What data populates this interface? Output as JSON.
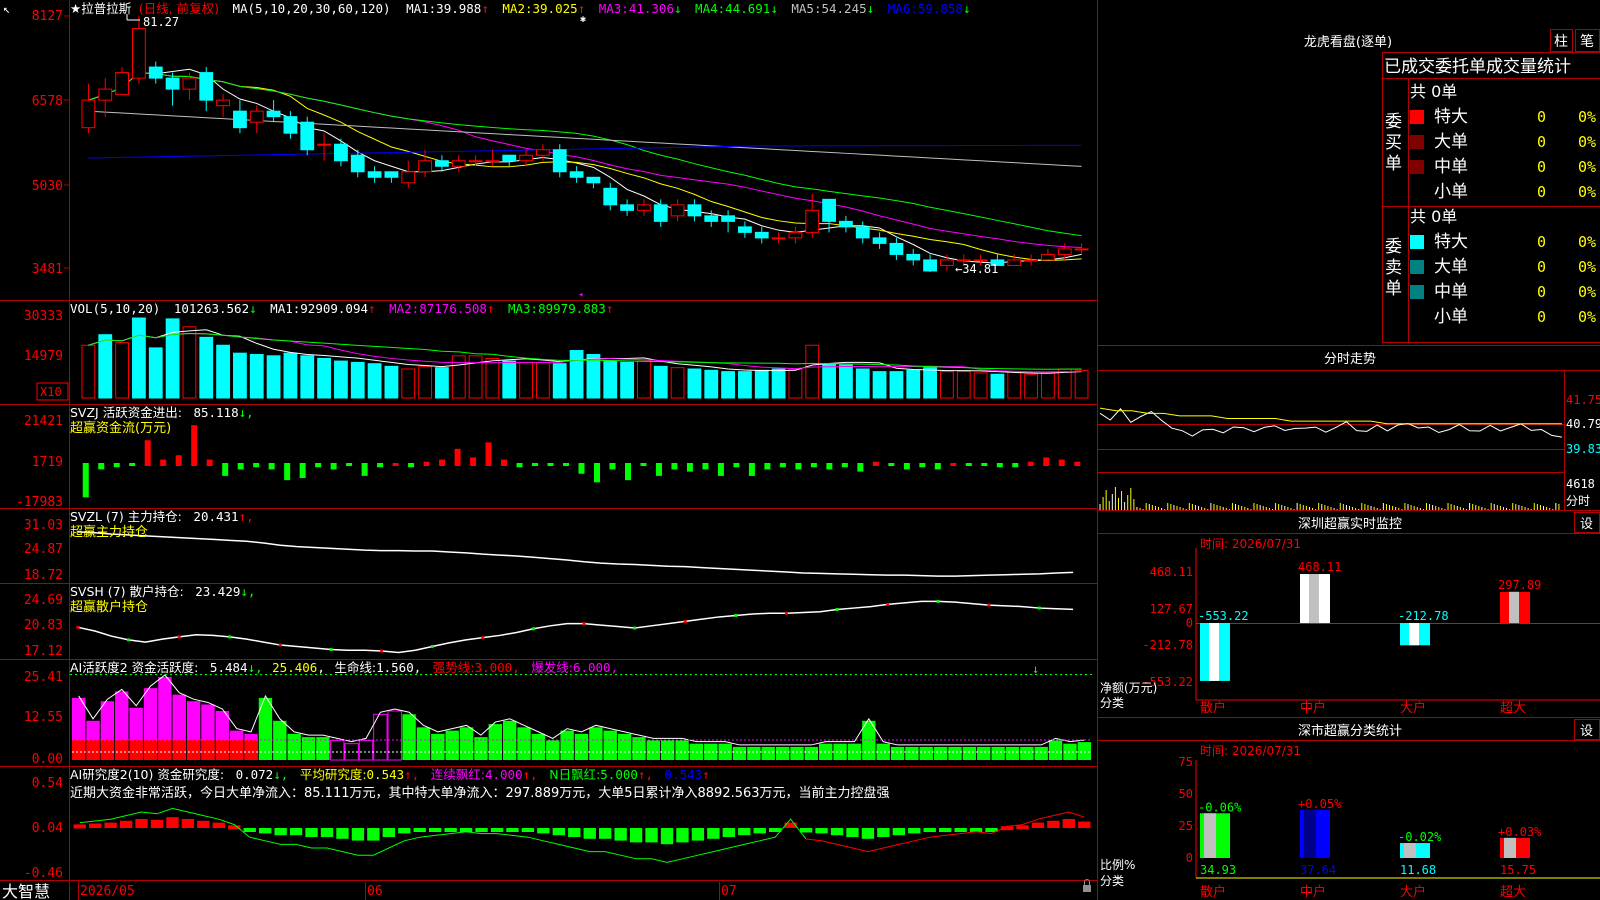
{
  "colors": {
    "red": "#ff0000",
    "cyan": "#00ffff",
    "green": "#00ff00",
    "white": "#ffffff",
    "yellow": "#ffff00",
    "magenta": "#ff00ff",
    "blue": "#0000ff",
    "gray": "#909090",
    "border": "#b00000",
    "grid": "#800000",
    "teal": "#008080",
    "darkred": "#800000"
  },
  "main": {
    "title": "★拉普拉斯",
    "period": "(日线, 前复权)",
    "ma_params": "MA(5,10,20,30,60,120)",
    "ma": [
      {
        "label": "MA1:",
        "value": "39.988",
        "arrow": "↑",
        "color": "#ffffff"
      },
      {
        "label": "MA2:",
        "value": "39.025",
        "arrow": "↑",
        "color": "#ffff00"
      },
      {
        "label": "MA3:",
        "value": "41.306",
        "arrow": "↓",
        "color": "#ff00ff"
      },
      {
        "label": "MA4:",
        "value": "44.691",
        "arrow": "↓",
        "color": "#00ff00"
      },
      {
        "label": "MA5:",
        "value": "54.245",
        "arrow": "↓",
        "color": "#c0c0c0"
      },
      {
        "label": "MA6:",
        "value": "59.858",
        "arrow": "↓",
        "color": "#0000ff"
      }
    ],
    "high_marker": "81.27",
    "low_marker": "←34.81",
    "yticks": [
      "8127",
      "6578",
      "5030",
      "3481"
    ],
    "app_name": "大智慧",
    "date_labels": [
      "2026/05",
      "06",
      "07"
    ]
  },
  "vol": {
    "params": "VOL(5,10,20)",
    "value": "101263.562",
    "arrow": "↓",
    "ma": [
      {
        "label": "MA1:",
        "value": "92909.094",
        "arrow": "↑",
        "color": "#ffffff"
      },
      {
        "label": "MA2:",
        "value": "87176.508",
        "arrow": "↑",
        "color": "#ff00ff"
      },
      {
        "label": "MA3:",
        "value": "89979.883",
        "arrow": "↑",
        "color": "#00ff00"
      }
    ],
    "yticks": [
      "30333",
      "14979"
    ],
    "unit": "X10"
  },
  "svzj": {
    "title": "SVZJ  活跃资金进出:",
    "value": "85.118",
    "arrow": "↓,",
    "subtitle": "超赢资金流(万元)",
    "yticks": [
      "21421",
      "1719",
      "-17983"
    ]
  },
  "svzl": {
    "title": "SVZL (7) 主力持仓:",
    "value": "20.431",
    "arrow": "↑,",
    "subtitle": "超赢主力持仓",
    "yticks": [
      "31.03",
      "24.87",
      "18.72"
    ]
  },
  "svsh": {
    "title": "SVSH (7) 散户持仓:",
    "value": "23.429",
    "arrow": "↓,",
    "subtitle": "超赢散户持仓",
    "yticks": [
      "24.69",
      "20.83",
      "17.12"
    ]
  },
  "ai_active": {
    "title": "AI活跃度2 资金活跃度:",
    "value": "5.484",
    "arrow": "↓,",
    "value2": "25.406",
    "life_label": "生命线:",
    "life_value": "1.560",
    "strong_label": "强势线:",
    "strong_value": "3.000",
    "burst_label": "爆发线:",
    "burst_value": "6.000",
    "yticks": [
      "25.41",
      "12.55",
      "0.00"
    ]
  },
  "ai_research": {
    "title": "AI研究度2(10) 资金研究度:",
    "value": "0.072",
    "arrow": "↓,",
    "avg_label": "平均研究度:",
    "avg_value": "0.543",
    "avg_arrow": "↑,",
    "streak_label": "连续飘红:",
    "streak_value": "4.000",
    "nday_label": "N日飘红:",
    "nday_value": "5.000",
    "last_value": "0.543",
    "comment": "近期大资金非常活跃，今日大单净流入：85.111万元，其中特大单净流入：297.889万元，大单5日累计净入8892.563万元，当前主力控盘强",
    "yticks": [
      "0.54",
      "0.04",
      "-0.46"
    ]
  },
  "side": {
    "longhu_title": "龙虎看盘(逐单)",
    "btn_bar": "柱",
    "btn_stroke": "笔",
    "order_title": "已成交委托单成交量统计",
    "buy_group": "委买单",
    "sell_group": "委卖单",
    "buy_total": "共 0单",
    "sell_total": "共 0单",
    "buy_rows": [
      {
        "label": "特大",
        "count": "0",
        "pct": "0%",
        "color": "#ff0000"
      },
      {
        "label": "大单",
        "count": "0",
        "pct": "0%",
        "color": "#800000"
      },
      {
        "label": "中单",
        "count": "0",
        "pct": "0%",
        "color": "#800000"
      },
      {
        "label": "小单",
        "count": "0",
        "pct": "0%",
        "color": ""
      }
    ],
    "sell_rows": [
      {
        "label": "特大",
        "count": "0",
        "pct": "0%",
        "color": "#00ffff"
      },
      {
        "label": "大单",
        "count": "0",
        "pct": "0%",
        "color": "#008080"
      },
      {
        "label": "中单",
        "count": "0",
        "pct": "0%",
        "color": "#008080"
      },
      {
        "label": "小单",
        "count": "0",
        "pct": "0%",
        "color": ""
      }
    ],
    "intraday_title": "分时走势",
    "intraday_prices": [
      "41.75",
      "40.79",
      "39.83"
    ],
    "intraday_vol": "4618",
    "intraday_unit": "分时",
    "monitor_title": "深圳超赢实时监控",
    "monitor_btn": "设",
    "monitor_time": "时间: 2026/07/31",
    "monitor_yticks": [
      "468.11",
      "127.67",
      "0",
      "-212.78",
      "-553.22"
    ],
    "monitor_ylabel": "净额(万元)",
    "monitor_xlabel": "分类",
    "stats_title": "深市超赢分类统计",
    "stats_btn": "设",
    "stats_time": "时间: 2026/07/31",
    "stats_yticks": [
      "75",
      "50",
      "25",
      "0"
    ],
    "stats_ylabel": "比例%",
    "stats_xlabel": "分类"
  },
  "chart_data": [
    {
      "type": "candlestick",
      "title": "拉普拉斯 日线 前复权",
      "categories": [
        "散户",
        "中户",
        "大户",
        "超大"
      ],
      "ylim": [
        34.81,
        81.27
      ],
      "candles": [
        [
          61,
          66,
          60,
          69
        ],
        [
          66,
          68,
          63,
          70
        ],
        [
          67,
          71,
          67,
          72
        ],
        [
          70,
          79,
          69,
          81.27
        ],
        [
          72,
          70,
          69,
          73
        ],
        [
          70,
          68,
          65,
          71
        ],
        [
          68,
          70,
          66,
          71
        ],
        [
          71,
          66,
          64,
          72
        ],
        [
          65,
          66,
          63,
          67
        ],
        [
          64,
          61,
          60,
          66
        ],
        [
          62,
          64,
          60,
          65
        ],
        [
          64,
          63,
          62,
          66
        ],
        [
          63,
          60,
          59,
          64
        ],
        [
          62,
          57,
          56,
          63
        ],
        [
          58,
          58,
          55,
          60
        ],
        [
          58,
          55,
          54,
          59
        ],
        [
          56,
          53,
          52,
          57
        ],
        [
          53,
          52,
          51,
          54
        ],
        [
          53,
          52,
          51,
          53
        ],
        [
          51,
          53,
          50,
          55
        ],
        [
          53,
          55,
          52,
          57
        ],
        [
          55,
          54,
          53,
          56
        ],
        [
          54,
          55,
          53,
          56
        ],
        [
          55,
          55,
          54,
          56
        ],
        [
          55,
          55,
          54,
          57
        ],
        [
          56,
          55,
          54,
          56
        ],
        [
          55,
          56,
          54,
          57
        ],
        [
          56,
          57,
          55,
          58
        ],
        [
          57,
          53,
          52,
          58
        ],
        [
          53,
          52,
          51,
          54
        ],
        [
          52,
          51,
          50,
          52
        ],
        [
          50,
          47,
          46,
          51
        ],
        [
          47,
          46,
          45,
          48
        ],
        [
          46,
          47,
          45,
          48
        ],
        [
          47,
          44,
          43,
          48
        ],
        [
          45,
          47,
          44,
          48
        ],
        [
          47,
          45,
          44,
          48
        ],
        [
          45,
          44,
          43,
          46
        ],
        [
          45,
          44,
          42,
          46
        ],
        [
          43,
          42,
          41,
          44
        ],
        [
          42,
          41,
          40,
          43
        ],
        [
          41,
          41,
          40,
          42
        ],
        [
          41,
          42,
          40,
          43
        ],
        [
          42,
          46,
          41,
          49
        ],
        [
          48,
          44,
          42,
          48
        ],
        [
          44,
          43,
          42,
          45
        ],
        [
          43,
          41,
          40,
          44
        ],
        [
          41,
          40,
          39,
          42
        ],
        [
          40,
          38,
          37,
          41
        ],
        [
          38,
          37,
          36,
          39
        ],
        [
          37,
          35,
          34.81,
          38
        ],
        [
          36,
          37,
          35,
          38
        ],
        [
          37,
          37,
          36,
          38
        ],
        [
          37,
          37,
          36,
          38
        ],
        [
          37,
          36,
          36,
          38
        ],
        [
          36,
          37,
          36,
          38
        ],
        [
          37,
          37,
          36,
          38
        ],
        [
          37,
          38,
          37,
          39
        ],
        [
          38,
          39,
          37,
          40
        ],
        [
          39,
          39,
          38,
          40
        ]
      ],
      "ma_series": [
        {
          "name": "MA1",
          "color": "#ffffff"
        },
        {
          "name": "MA2",
          "color": "#ffff00"
        },
        {
          "name": "MA3",
          "color": "#ff00ff"
        },
        {
          "name": "MA4",
          "color": "#00ff00"
        },
        {
          "name": "MA5",
          "color": "#c0c0c0"
        },
        {
          "name": "MA6",
          "color": "#0000ff"
        }
      ]
    },
    {
      "type": "bar",
      "title": "VOL(5,10,20)",
      "ylim": [
        0,
        30333
      ],
      "values": [
        20000,
        24000,
        21000,
        30333,
        19000,
        30000,
        27000,
        23000,
        20000,
        17000,
        16500,
        16000,
        17000,
        16000,
        15000,
        14000,
        13500,
        13000,
        12000,
        11000,
        12000,
        11500,
        16000,
        16000,
        15000,
        14000,
        13500,
        13500,
        13000,
        18000,
        16500,
        14000,
        13500,
        14000,
        12000,
        11500,
        11000,
        10500,
        10000,
        10000,
        10500,
        11000,
        11000,
        20000,
        13000,
        12500,
        11000,
        10000,
        10000,
        10500,
        11500,
        10000,
        10000,
        9500,
        9000,
        10000,
        9000,
        9500,
        11000,
        10500
      ],
      "rise": [
        1,
        0,
        1,
        0,
        0,
        0,
        1,
        0,
        0,
        0,
        0,
        0,
        0,
        0,
        0,
        0,
        0,
        0,
        0,
        1,
        1,
        0,
        1,
        1,
        1,
        0,
        1,
        1,
        0,
        0,
        0,
        0,
        0,
        1,
        0,
        1,
        0,
        0,
        0,
        0,
        0,
        0,
        1,
        1,
        0,
        0,
        0,
        0,
        0,
        0,
        0,
        1,
        1,
        1,
        0,
        1,
        1,
        1,
        1,
        1
      ]
    },
    {
      "type": "bar",
      "title": "SVZJ 活跃资金进出",
      "ylim": [
        -17983,
        21421
      ],
      "values": [
        -16000,
        -3000,
        -2000,
        -1000,
        12000,
        3000,
        5000,
        19000,
        3000,
        -6000,
        -3000,
        -2000,
        -3000,
        -8000,
        -7000,
        -2000,
        -3000,
        -1000,
        -6000,
        -2000,
        1000,
        -2000,
        2000,
        3000,
        8000,
        4000,
        11000,
        3000,
        -2000,
        -1000,
        -1000,
        -1000,
        -5000,
        -9000,
        -3000,
        -8000,
        -1000,
        -6000,
        -3000,
        -4000,
        -3000,
        -6000,
        -2000,
        -6000,
        -3000,
        -2000,
        -3000,
        -2000,
        -3000,
        -2000,
        -4000,
        2000,
        -1000,
        -3000,
        -2000,
        -3000,
        1000,
        -1000,
        -1000,
        -2000,
        -2000,
        2000,
        4000,
        3000,
        2000
      ],
      "ylabel": "超赢资金流(万元)"
    },
    {
      "type": "line",
      "title": "SVZL 主力持仓",
      "ylim": [
        18.72,
        31.03
      ],
      "values": [
        29.5,
        29.3,
        29.0,
        28.8,
        28.6,
        28.4,
        28.2,
        28.0,
        27.8,
        27.6,
        27.4,
        27.0,
        26.5,
        26.2,
        26.0,
        25.8,
        25.6,
        25.4,
        25.3,
        25.3,
        25.2,
        25.2,
        25.0,
        24.8,
        24.5,
        24.3,
        24.1,
        23.8,
        23.5,
        23.2,
        22.8,
        22.5,
        22.3,
        22.2,
        22.0,
        21.8,
        21.7,
        21.5,
        21.3,
        21.1,
        20.9,
        20.7,
        20.5,
        20.3,
        20.2,
        20.1,
        20.0,
        19.9,
        19.8,
        19.8,
        19.7,
        19.6,
        19.6,
        19.7,
        19.8,
        19.9,
        20.0,
        20.1,
        20.3,
        20.431
      ]
    },
    {
      "type": "line",
      "title": "SVSH 散户持仓",
      "ylim": [
        17.12,
        24.69
      ],
      "values": [
        21.0,
        20.5,
        19.8,
        19.3,
        19.0,
        19.4,
        19.7,
        20.0,
        19.9,
        19.7,
        19.4,
        19.0,
        18.6,
        18.4,
        18.2,
        18.0,
        17.9,
        17.9,
        17.8,
        17.6,
        17.9,
        18.4,
        18.9,
        19.3,
        19.6,
        19.9,
        20.3,
        20.8,
        21.2,
        21.5,
        21.5,
        21.3,
        21.1,
        20.9,
        21.2,
        21.5,
        21.8,
        22.1,
        22.4,
        22.6,
        22.8,
        22.9,
        22.9,
        23.0,
        23.1,
        23.4,
        23.6,
        23.8,
        24.1,
        24.3,
        24.5,
        24.5,
        24.4,
        24.2,
        24.0,
        23.9,
        23.8,
        23.6,
        23.5,
        23.429
      ]
    },
    {
      "type": "bar",
      "title": "AI活跃度2 资金活跃度",
      "ylim": [
        0,
        25.41
      ],
      "values": [
        19,
        12,
        18,
        21,
        16,
        22,
        25.41,
        20,
        18,
        17,
        15,
        9,
        8,
        19,
        12,
        8,
        7,
        7,
        6,
        5,
        6,
        14,
        15,
        14,
        10,
        8,
        9,
        10,
        7,
        11,
        12,
        10,
        8,
        6,
        9,
        8,
        10,
        9,
        8,
        7,
        6,
        6,
        6,
        5,
        5,
        5,
        4,
        4,
        4,
        4,
        4,
        4,
        5,
        5,
        5,
        12,
        5,
        4,
        4,
        4,
        4,
        4,
        4,
        4,
        4,
        4,
        4,
        4,
        6,
        5,
        5.484
      ],
      "strong_line": 3.0,
      "burst_line": 6.0,
      "life_line": 1.56
    },
    {
      "type": "bar",
      "title": "AI研究度2(10) 资金研究度",
      "ylim": [
        -0.46,
        0.54
      ],
      "values": [
        0.04,
        0.05,
        0.06,
        0.08,
        0.1,
        0.09,
        0.12,
        0.1,
        0.08,
        0.06,
        0.03,
        -0.04,
        -0.06,
        -0.08,
        -0.08,
        -0.1,
        -0.1,
        -0.12,
        -0.14,
        -0.14,
        -0.1,
        -0.06,
        -0.04,
        -0.03,
        -0.02,
        -0.01,
        -0.02,
        -0.02,
        -0.03,
        -0.04,
        -0.06,
        -0.08,
        -0.1,
        -0.12,
        -0.12,
        -0.14,
        -0.16,
        -0.16,
        -0.18,
        -0.16,
        -0.14,
        -0.12,
        -0.1,
        -0.08,
        -0.06,
        -0.04,
        0.06,
        -0.05,
        -0.06,
        -0.08,
        -0.1,
        -0.12,
        -0.1,
        -0.08,
        -0.06,
        -0.04,
        -0.03,
        -0.02,
        -0.01,
        -0.02,
        0.02,
        0.03,
        0.06,
        0.08,
        0.1,
        0.072
      ]
    },
    {
      "type": "line",
      "title": "分时走势",
      "ylim": [
        39.83,
        41.75
      ],
      "values": [
        41.2,
        41.0,
        41.3,
        40.9,
        41.1,
        41.2,
        41.0,
        40.6,
        40.5,
        40.4,
        40.5,
        40.6,
        40.5,
        40.6,
        40.7,
        40.5,
        40.6,
        40.8,
        40.5,
        40.6,
        40.7,
        40.6,
        40.5,
        40.7,
        40.8,
        40.6,
        40.5,
        40.7,
        40.6,
        40.7,
        40.8,
        40.7,
        40.6,
        40.5,
        40.6,
        40.7,
        40.6,
        40.5,
        40.7,
        40.6,
        40.6,
        40.8,
        40.6,
        40.5,
        40.4,
        40.3
      ],
      "avg_line": [
        41.4,
        41.3,
        41.3,
        41.2,
        41.2,
        41.1,
        41.1,
        41.1,
        41.0,
        41.0,
        41.0,
        41.0,
        40.9,
        40.9,
        40.9,
        40.9,
        40.9,
        40.9,
        40.8,
        40.8,
        40.8,
        40.8,
        40.8,
        40.8,
        40.8,
        40.8,
        40.8,
        40.8,
        40.8,
        40.8
      ]
    },
    {
      "type": "bar",
      "title": "深圳超赢实时监控",
      "categories": [
        "散户",
        "中户",
        "大户",
        "超大"
      ],
      "values": [
        -553.22,
        468.11,
        -212.78,
        297.89
      ],
      "ylim": [
        -553.22,
        468.11
      ],
      "xlabel": "分类",
      "ylabel": "净额(万元)"
    },
    {
      "type": "bar",
      "title": "深市超赢分类统计",
      "categories": [
        "散户",
        "中户",
        "大户",
        "超大"
      ],
      "values": [
        34.93,
        37.64,
        11.68,
        15.75
      ],
      "changes": [
        "-0.06%",
        "+0.05%",
        "-0.02%",
        "+0.03%"
      ],
      "ylim": [
        0,
        75
      ],
      "xlabel": "分类",
      "ylabel": "比例%"
    }
  ]
}
